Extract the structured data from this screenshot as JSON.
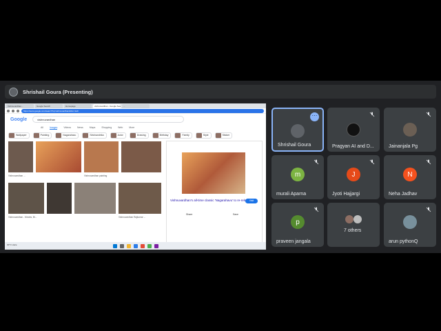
{
  "presenter": {
    "label": "Shrishail Goura (Presenting)"
  },
  "shared_screen": {
    "tabs": [
      "Vishnuvardhan...",
      "Google Search",
      "Homepage",
      "vishnuvardhan - Google Search",
      "..."
    ],
    "address": "https://www.google.com/search?q=vishnuvardhan&tbm=isch",
    "search_query": "vishnuvardhan",
    "google_tabs": [
      "All",
      "Images",
      "Videos",
      "News",
      "Maps",
      "Shopping",
      "Web",
      "More"
    ],
    "chips": [
      "Wallpaper",
      "Painting",
      "Nagarahavu",
      "Sirichandrika",
      "Actor",
      "Drawing",
      "Birthday",
      "Family",
      "Style",
      "Sticker"
    ],
    "captions": [
      "Vishnuvardhan ...",
      "Vishnuvardhan painting",
      "Vishnuvardhan - Movies, Bi...",
      "Vishnuvardhan Rajkumar ..."
    ],
    "panel_title": "Vishnuvardhan's all-time classic 'Nagarahavu' to re-release",
    "panel_visit": "Visit",
    "panel_share": "Share",
    "panel_save": "Save",
    "temp": "30°C Haze"
  },
  "participants": [
    {
      "name": "Shrishail Goura",
      "initial": "",
      "color": "#5f6368",
      "speaking": true
    },
    {
      "name": "Pragyan AI and D...",
      "initial": "",
      "color": "#111111",
      "speaking": false
    },
    {
      "name": "Jainanjala Pg",
      "initial": "",
      "color": "#6b5f54",
      "speaking": false
    },
    {
      "name": "murali Aparna",
      "initial": "m",
      "color": "#7cb342",
      "speaking": false
    },
    {
      "name": "Jyoti Hajjargi",
      "initial": "J",
      "color": "#e64a19",
      "speaking": false
    },
    {
      "name": "Neha Jadhav",
      "initial": "N",
      "color": "#f4511e",
      "speaking": false
    },
    {
      "name": "praveen jangala",
      "initial": "p",
      "color": "#558b2f",
      "speaking": false
    },
    {
      "name": "7 others",
      "initial": "",
      "color": "#3c4043",
      "speaking": false
    },
    {
      "name": "arun pythonQ",
      "initial": "",
      "color": "#78909c",
      "speaking": false
    }
  ]
}
